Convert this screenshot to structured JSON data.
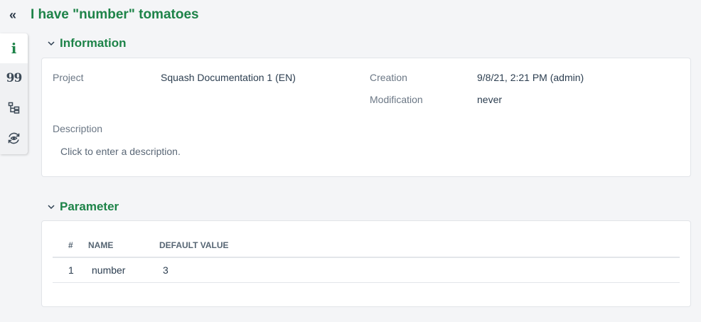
{
  "header": {
    "title": "I have \"number\" tomatoes"
  },
  "rail": {
    "items": [
      "info-icon",
      "quote-icon",
      "tree-icon",
      "eye-cycle-icon"
    ],
    "info_glyph": "i",
    "quote_glyph": "99"
  },
  "colors": {
    "accent": "#1d8348",
    "background": "#f4f5f7"
  },
  "information": {
    "section_title": "Information",
    "project_label": "Project",
    "project_value": "Squash Documentation 1 (EN)",
    "creation_label": "Creation",
    "creation_value": "9/8/21, 2:21 PM (admin)",
    "modification_label": "Modification",
    "modification_value": "never",
    "description_label": "Description",
    "description_placeholder": "Click to enter a description."
  },
  "parameter": {
    "section_title": "Parameter",
    "columns": [
      "#",
      "NAME",
      "DEFAULT VALUE"
    ],
    "rows": [
      {
        "index": "1",
        "name": "number",
        "default_value": "3"
      }
    ]
  }
}
